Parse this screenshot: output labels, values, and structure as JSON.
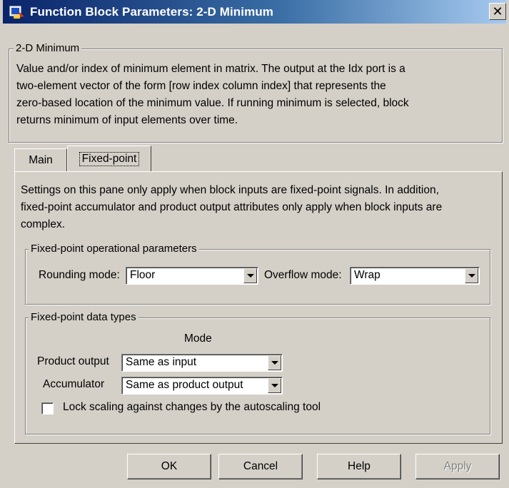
{
  "window": {
    "title": "Function Block Parameters: 2-D Minimum",
    "close_glyph": "✕"
  },
  "block": {
    "group_title": "2-D Minimum",
    "description_lines": [
      "Value and/or index of minimum element in matrix. The output at the Idx port is a",
      "two-element vector of the form [row index column index] that represents the",
      "zero-based location of the minimum value. If running minimum is selected, block",
      "returns minimum of input elements over time."
    ]
  },
  "tabs": [
    {
      "label": "Main"
    },
    {
      "label": "Fixed-point"
    }
  ],
  "fixed_point": {
    "info_lines": [
      "Settings on this pane only apply when block inputs are fixed-point signals. In addition,",
      "fixed-point accumulator and product output attributes only apply when block inputs are",
      "complex."
    ],
    "operational": {
      "title": "Fixed-point operational parameters",
      "rounding_label": "Rounding mode:",
      "rounding_value": "Floor",
      "overflow_label": "Overflow mode:",
      "overflow_value": "Wrap"
    },
    "data_types": {
      "title": "Fixed-point data types",
      "mode_header": "Mode",
      "product_output_label": "Product output",
      "product_output_value": "Same as input",
      "accumulator_label": "Accumulator",
      "accumulator_value": "Same as product output",
      "lock_scaling_label": "Lock scaling against changes by the autoscaling tool",
      "lock_scaling_checked": false
    }
  },
  "buttons": {
    "ok": "OK",
    "cancel": "Cancel",
    "help": "Help",
    "apply": "Apply"
  },
  "icons": {
    "app": "simulink-block-icon",
    "dropdown": "chevron-down-icon"
  }
}
